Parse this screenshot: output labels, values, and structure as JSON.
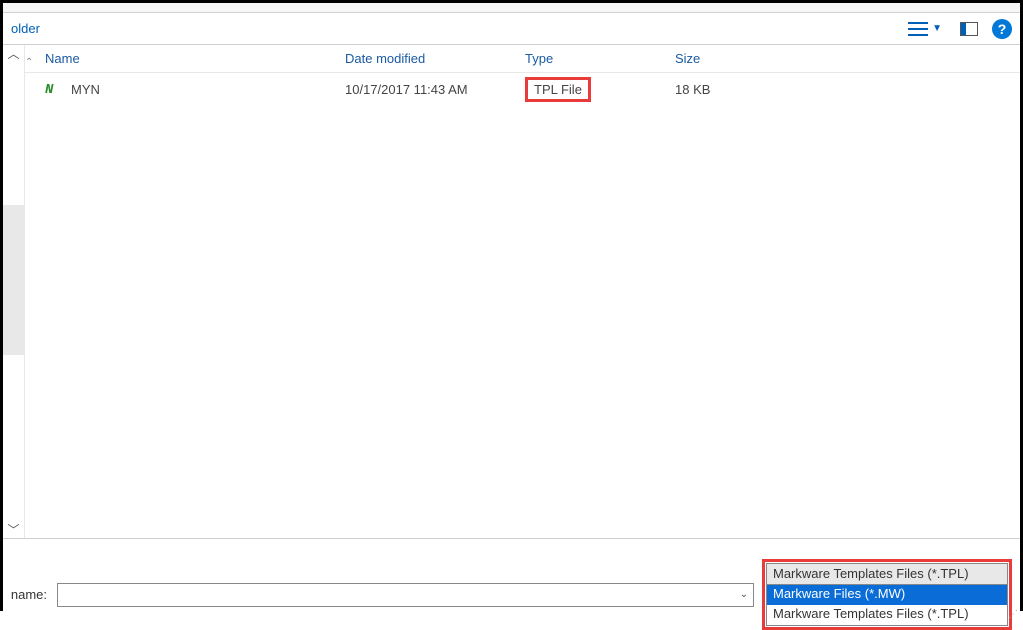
{
  "toolbar": {
    "left_text": "older"
  },
  "columns": {
    "name": "Name",
    "date": "Date modified",
    "type": "Type",
    "size": "Size"
  },
  "files": [
    {
      "name": "MYN",
      "date": "10/17/2017 11:43 AM",
      "type": "TPL File",
      "size": "18 KB"
    }
  ],
  "footer": {
    "name_label": "name:",
    "name_value": "",
    "filter_selected": "Markware Templates Files (*.TPL)",
    "filter_options": [
      "Markware Files (*.MW)",
      "Markware Templates Files (*.TPL)"
    ]
  }
}
